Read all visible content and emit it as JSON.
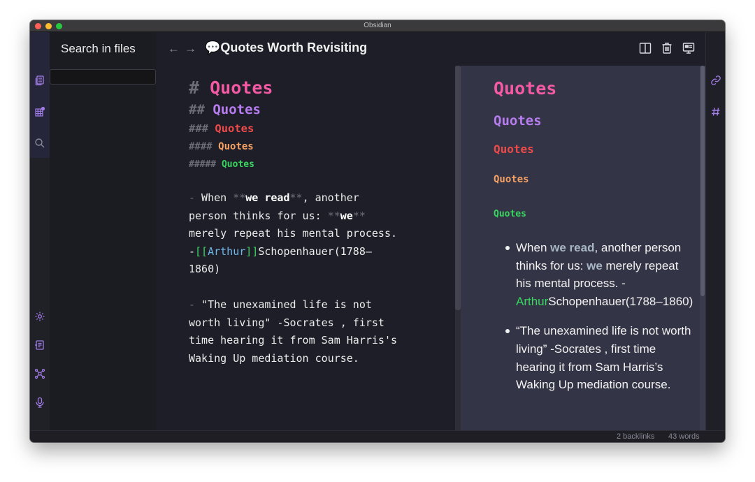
{
  "window": {
    "title": "Obsidian"
  },
  "sidebar": {
    "heading": "Search in files",
    "search_value": ""
  },
  "left_ribbon": {
    "top_icons": [
      "file-explorer-icon",
      "starred-grid-icon",
      "search-icon"
    ],
    "bottom_icons": [
      "settings-icon",
      "open-vault-icon",
      "graph-view-icon",
      "audio-recorder-icon"
    ]
  },
  "header": {
    "back": "←",
    "forward": "→",
    "note_title_emoji": "💬",
    "note_title": "Quotes Worth Revisiting",
    "actions": [
      "split-pane-icon",
      "trash-icon",
      "presentation-icon"
    ]
  },
  "editor": {
    "h1_marker": "#",
    "h1_text": "Quotes",
    "h2_marker": "##",
    "h2_text": "Quotes",
    "h3_marker": "###",
    "h3_text": "Quotes",
    "h4_marker": "####",
    "h4_text": "Quotes",
    "h5_marker": "#####",
    "h5_text": "Quotes",
    "q1": {
      "dash": "-",
      "p1": " When ",
      "bold_marker_open": "**",
      "bold1": "we read",
      "bold_marker_close": "**",
      "p2": ", another person thinks for us: ",
      "bold2_marker_open": "**",
      "bold2": "we",
      "bold2_marker_close": "**",
      "p3": " merely repeat his mental process. -",
      "link_open": "[[",
      "link": "Arthur",
      "link_close": "]]",
      "p4": "Schopenhauer(1788–1860)"
    },
    "q2": {
      "dash": " -",
      "text": " \"The unexamined life is not worth living\" -Socrates , first time hearing it from Sam Harris's Waking Up mediation course."
    }
  },
  "preview": {
    "h1": "Quotes",
    "h2": "Quotes",
    "h3": "Quotes",
    "h4": "Quotes",
    "h5": "Quotes",
    "item1": {
      "p1": "When ",
      "bold1": "we read",
      "p2": ", another person thinks for us: ",
      "bold2": "we",
      "p3": " merely repeat his mental process. -",
      "link": "Arthur",
      "p4": "Schopenhauer(1788–1860)"
    },
    "item2": {
      "text": "“The unexamined life is not worth living” -Socrates , first time hearing it from Sam Harris’s Waking Up mediation course."
    }
  },
  "right_ribbon": {
    "icons": [
      "backlinks-link-icon",
      "tags-hash-icon"
    ]
  },
  "status": {
    "backlinks": "2 backlinks",
    "words": "43 words"
  },
  "colors": {
    "h1": "#f35aa4",
    "h2": "#b77df1",
    "h3": "#ef4a4a",
    "h4": "#f6a264",
    "h5": "#39d55f",
    "accent_icon": "#a27de8",
    "link": "#6fb7e8"
  }
}
